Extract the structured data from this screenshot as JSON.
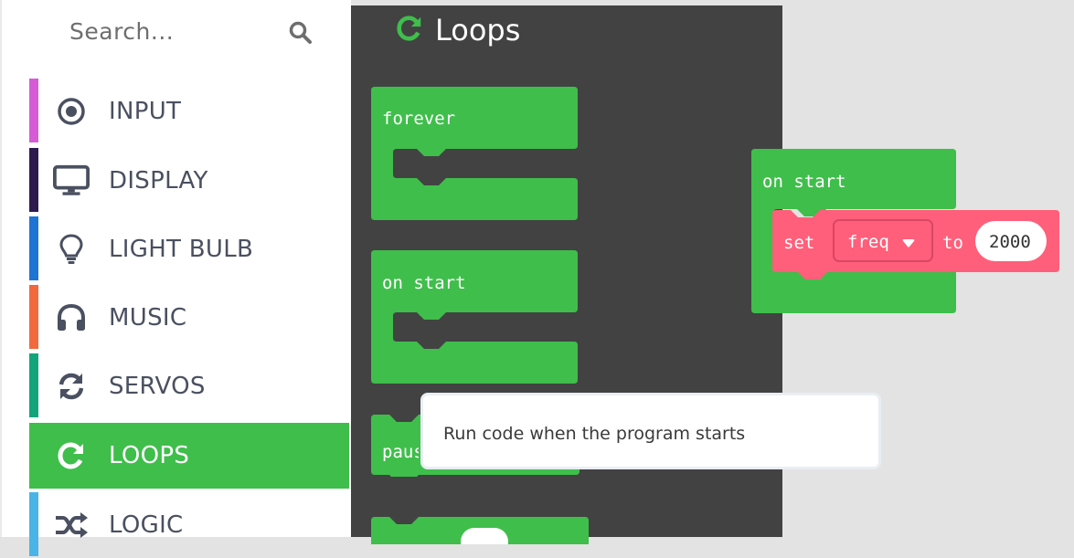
{
  "search": {
    "placeholder": "Search..."
  },
  "categories": [
    {
      "label": "INPUT",
      "icon": "target-icon",
      "color": "#d65cd6"
    },
    {
      "label": "DISPLAY",
      "icon": "monitor-icon",
      "color": "#2d1b4e"
    },
    {
      "label": "LIGHT BULB",
      "icon": "lightbulb-icon",
      "color": "#1e74d4"
    },
    {
      "label": "MUSIC",
      "icon": "headphones-icon",
      "color": "#f06a3e"
    },
    {
      "label": "SERVOS",
      "icon": "sync-icon",
      "color": "#12a57b"
    },
    {
      "label": "LOOPS",
      "icon": "refresh-icon",
      "color": "#3fbe4b",
      "selected": true
    },
    {
      "label": "LOGIC",
      "icon": "shuffle-icon",
      "color": "#4ab4e6"
    }
  ],
  "flyout": {
    "title": "Loops",
    "blocks": [
      {
        "label": "forever"
      },
      {
        "label": "on start"
      },
      {
        "label": "pause"
      }
    ]
  },
  "workspace": {
    "on_start_label": "on start",
    "set_block": {
      "keyword": "set",
      "variable": "freq",
      "to": "to",
      "value": "2000"
    }
  },
  "tooltip": {
    "text": "Run code when the program starts"
  },
  "colors": {
    "loops_green": "#3fbe4b",
    "variables_red": "#ff5f7a",
    "flyout_bg": "#424242",
    "workspace_bg": "#e3e3e3"
  }
}
